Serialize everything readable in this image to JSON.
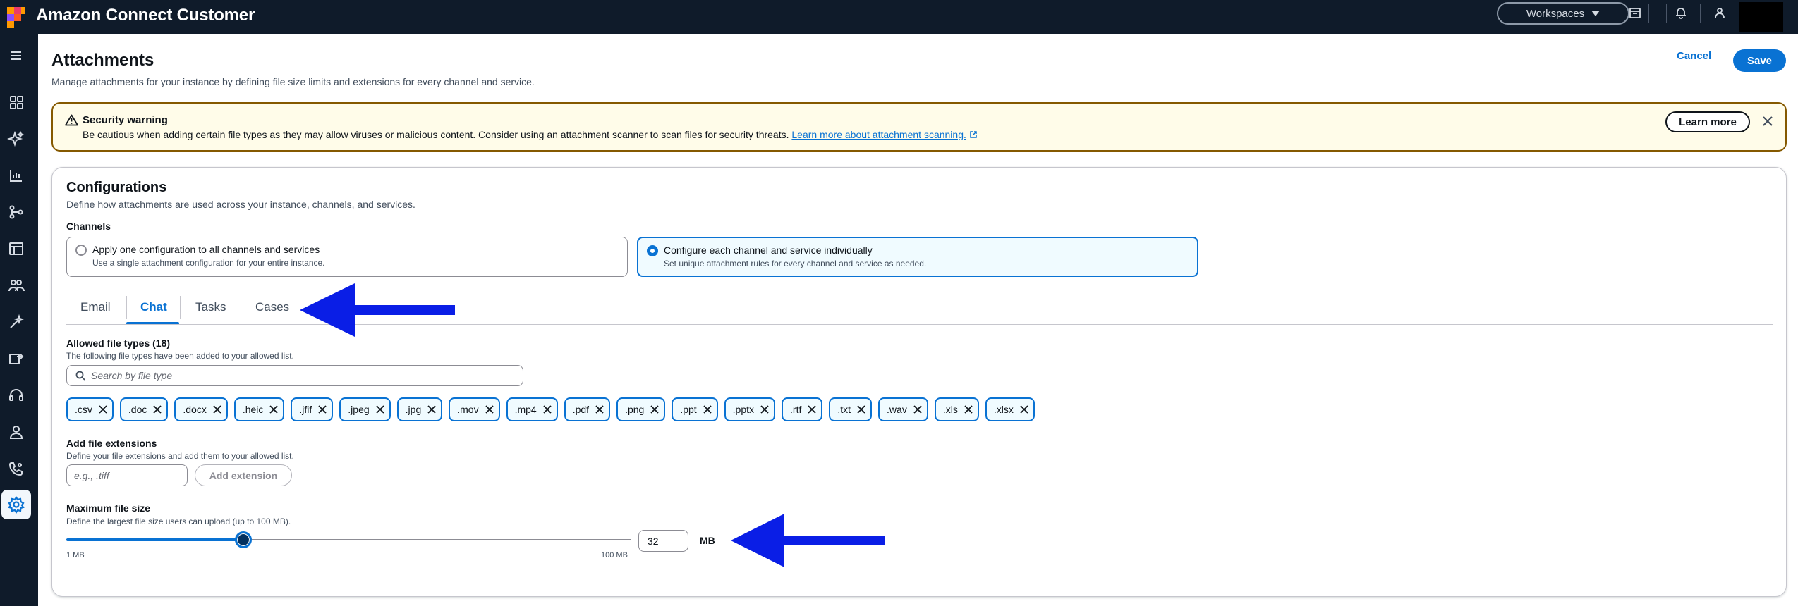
{
  "app": {
    "title": "Amazon Connect Customer",
    "workspaces_label": "Workspaces"
  },
  "page": {
    "title": "Attachments",
    "description": "Manage attachments for your instance by defining file size limits and extensions for every channel and service.",
    "cancel_label": "Cancel",
    "save_label": "Save"
  },
  "warning": {
    "title": "Security warning",
    "text": "Be cautious when adding certain file types as they may allow viruses or malicious content. Consider using an attachment scanner to scan files for security threats.",
    "link": "Learn more about attachment scanning.",
    "learn_more_label": "Learn more"
  },
  "config": {
    "title": "Configurations",
    "description": "Define how attachments are used across your instance, channels, and services.",
    "channels_label": "Channels",
    "options": [
      {
        "label": "Apply one configuration to all channels and services",
        "sub": "Use a single attachment configuration for your entire instance.",
        "selected": false
      },
      {
        "label": "Configure each channel and service individually",
        "sub": "Set unique attachment rules for every channel and service as needed.",
        "selected": true
      }
    ]
  },
  "tabs": [
    {
      "label": "Email",
      "active": false
    },
    {
      "label": "Chat",
      "active": true
    },
    {
      "label": "Tasks",
      "active": false
    },
    {
      "label": "Cases",
      "active": false
    }
  ],
  "file_types": {
    "title": "Allowed file types (18)",
    "description": "The following file types have been added to your allowed list.",
    "search_placeholder": "Search by file type",
    "items": [
      ".csv",
      ".doc",
      ".docx",
      ".heic",
      ".jfif",
      ".jpeg",
      ".jpg",
      ".mov",
      ".mp4",
      ".pdf",
      ".png",
      ".ppt",
      ".pptx",
      ".rtf",
      ".txt",
      ".wav",
      ".xls",
      ".xlsx"
    ]
  },
  "add_extensions": {
    "title": "Add file extensions",
    "description": "Define your file extensions and add them to your allowed list.",
    "placeholder": "e.g., .tiff",
    "button_label": "Add extension"
  },
  "max_size": {
    "title": "Maximum file size",
    "description": "Define the largest file size users can upload (up to 100 MB).",
    "min_label": "1 MB",
    "max_label": "100 MB",
    "min": 1,
    "max": 100,
    "value": "32",
    "unit": "MB"
  },
  "colors": {
    "accent": "#0972d3",
    "topbar": "#0f1b2a",
    "annotation_arrow": "#0a1ee6"
  }
}
